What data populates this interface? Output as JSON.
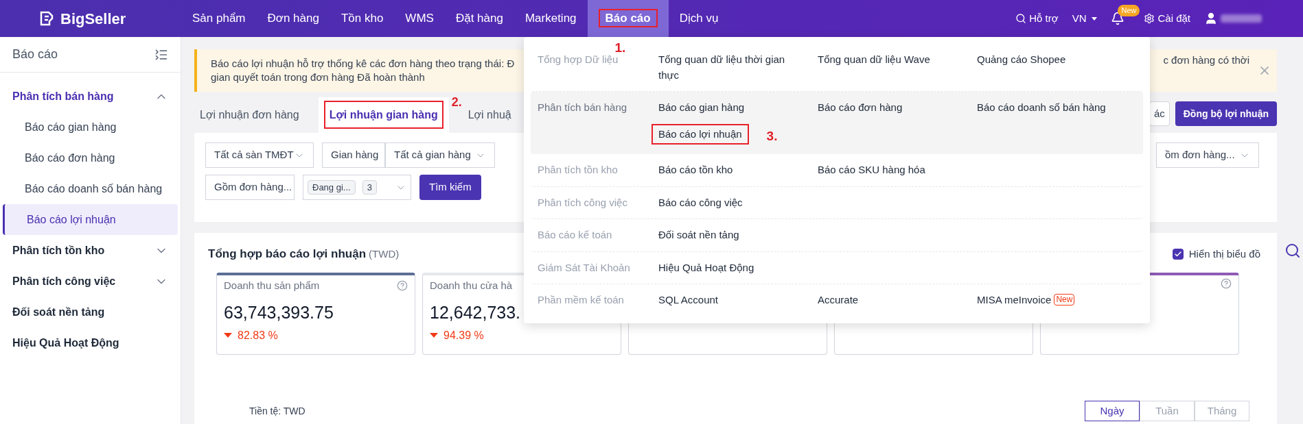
{
  "topbar": {
    "logo": "BigSeller",
    "nav": [
      {
        "label": "Sản phẩm",
        "selected": false
      },
      {
        "label": "Đơn hàng",
        "selected": false
      },
      {
        "label": "Tồn kho",
        "selected": false
      },
      {
        "label": "WMS",
        "selected": false
      },
      {
        "label": "Đặt hàng",
        "selected": false
      },
      {
        "label": "Marketing",
        "selected": false
      },
      {
        "label": "Báo cáo",
        "selected": true,
        "annotation": "1."
      },
      {
        "label": "Dịch vụ",
        "selected": false
      }
    ],
    "support": "Hỗ trợ",
    "language": "VN",
    "bell_badge": "New",
    "settings": "Cài đặt"
  },
  "sidebar": {
    "title": "Báo cáo",
    "groups": [
      {
        "label": "Phân tích bán hàng",
        "expanded": true,
        "children": [
          {
            "label": "Báo cáo gian hàng",
            "selected": false
          },
          {
            "label": "Báo cáo đơn hàng",
            "selected": false
          },
          {
            "label": "Báo cáo doanh số bán hàng",
            "selected": false
          },
          {
            "label": "Báo cáo lợi nhuận",
            "selected": true
          }
        ]
      },
      {
        "label": "Phân tích tồn kho",
        "expanded": false
      },
      {
        "label": "Phân tích công việc",
        "expanded": false
      },
      {
        "label": "Đối soát nền tảng"
      },
      {
        "label": "Hiệu Quả Hoạt Động"
      }
    ]
  },
  "banner": {
    "text_left": "Báo cáo lợi nhuận hỗ trợ thống kê các đơn hàng theo trạng thái: Đ",
    "text_left_line2": "gian quyết toán trong đơn hàng Đã hoàn thành",
    "text_right": "c đơn hàng có thời"
  },
  "tabs": [
    {
      "label": "Lợi nhuận đơn hàng",
      "selected": false
    },
    {
      "label": "Lợi nhuận gian hàng",
      "selected": true,
      "annotation": "2."
    },
    {
      "label": "Lợi nhuậ",
      "selected": false
    }
  ],
  "actions": [
    "ác",
    "Đồng bộ lợi nhuận"
  ],
  "filters": {
    "row_1": [
      {
        "value": "Tất cả sàn TMĐT"
      },
      {
        "value": "Gian hàng"
      },
      {
        "value": "Tất cả gian hàng"
      }
    ],
    "row_1_right": {
      "value": "ồm đơn hàng..."
    },
    "row_2": {
      "select": "Gồm đơn hàng...",
      "tag": "Đang gi...",
      "count": "3",
      "search_button": "Tìm kiếm"
    }
  },
  "summary": {
    "title": "Tổng hợp báo cáo lợi nhuận",
    "currency": "(TWD)",
    "show_chart": {
      "label": "Hiển thị biểu đồ",
      "checked": true
    },
    "cards": [
      {
        "label": "Doanh thu sản phẩm",
        "value": "63,743,393.75",
        "change": "82.83 %",
        "color": "#5b6e96"
      },
      {
        "label": "Doanh thu cửa hà",
        "value": "12,642,733.",
        "change": "94.39 %",
        "color": "#e5e7eb"
      },
      {
        "color": "#e5e7eb"
      },
      {
        "color": "#e5e7eb"
      },
      {
        "color": "#8e5bb5"
      }
    ]
  },
  "chart_header": {
    "currency": "Tiền tệ: TWD",
    "periods": [
      {
        "label": "Ngày",
        "selected": true
      },
      {
        "label": "Tuần",
        "selected": false
      },
      {
        "label": "Tháng",
        "selected": false
      }
    ]
  },
  "menu": {
    "rows": [
      {
        "category": "Tổng hợp Dữ liệu",
        "highlighted": false,
        "items": [
          {
            "label": "Tổng quan dữ liệu thời gian thực"
          },
          {
            "label": "Tổng quan dữ liệu Wave"
          },
          {
            "label": "Quảng cáo Shopee"
          }
        ]
      },
      {
        "category": "Phân tích bán hàng",
        "highlighted": true,
        "items": [
          {
            "label": "Báo cáo gian hàng"
          },
          {
            "label": "Báo cáo đơn hàng"
          },
          {
            "label": "Báo cáo doanh số bán hàng"
          },
          {
            "label": "Báo cáo lợi nhuận",
            "annotation": "3."
          }
        ]
      },
      {
        "category": "Phân tích tồn kho",
        "highlighted": false,
        "items": [
          {
            "label": "Báo cáo tồn kho"
          },
          {
            "label": "Báo cáo SKU hàng hóa"
          }
        ]
      },
      {
        "category": "Phân tích công việc",
        "highlighted": false,
        "items": [
          {
            "label": "Báo cáo công việc"
          }
        ]
      },
      {
        "category": "Báo cáo kế toán",
        "highlighted": false,
        "items": [
          {
            "label": "Đối soát nền tảng"
          }
        ]
      },
      {
        "category": "Giám Sát Tài Khoản",
        "highlighted": false,
        "items": [
          {
            "label": "Hiệu Quả Hoạt Động"
          }
        ]
      },
      {
        "category": "Phần mềm kế toán",
        "highlighted": false,
        "items": [
          {
            "label": "SQL Account"
          },
          {
            "label": "Accurate"
          },
          {
            "label": "MISA meInvoice",
            "badge": "New"
          }
        ]
      }
    ]
  }
}
